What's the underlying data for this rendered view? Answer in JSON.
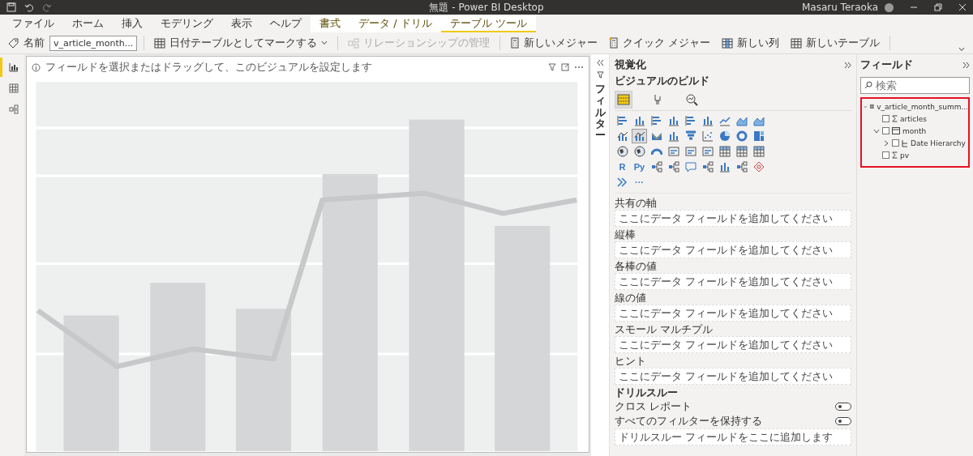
{
  "title_bar": {
    "title": "無題 - Power BI Desktop",
    "user": "Masaru Teraoka"
  },
  "menu_tabs": [
    {
      "label": "ファイル",
      "contextual": false,
      "selected": false
    },
    {
      "label": "ホーム",
      "contextual": false,
      "selected": false
    },
    {
      "label": "挿入",
      "contextual": false,
      "selected": false
    },
    {
      "label": "モデリング",
      "contextual": false,
      "selected": false
    },
    {
      "label": "表示",
      "contextual": false,
      "selected": false
    },
    {
      "label": "ヘルプ",
      "contextual": false,
      "selected": false
    },
    {
      "label": "書式",
      "contextual": true,
      "selected": false
    },
    {
      "label": "データ / ドリル",
      "contextual": true,
      "selected": false
    },
    {
      "label": "テーブル ツール",
      "contextual": true,
      "selected": true
    }
  ],
  "ribbon": {
    "name_label": "名前",
    "name_value": "v_article_month...",
    "buttons": [
      {
        "label": "日付テーブルとしてマークする",
        "kind": "dropdown",
        "disabled": false
      },
      {
        "label": "リレーションシップの管理",
        "kind": "button",
        "disabled": true
      },
      {
        "label": "新しいメジャー",
        "kind": "button",
        "disabled": false
      },
      {
        "label": "クイック メジャー",
        "kind": "button",
        "disabled": false
      },
      {
        "label": "新しい列",
        "kind": "button",
        "disabled": false
      },
      {
        "label": "新しいテーブル",
        "kind": "button",
        "disabled": false
      }
    ]
  },
  "views": [
    {
      "selected": true
    },
    {
      "selected": false
    },
    {
      "selected": false
    }
  ],
  "canvas": {
    "hint": "フィールドを選択またはドラッグして、このビジュアルを設定します"
  },
  "filters": {
    "label": "フィルター"
  },
  "visualizations": {
    "title": "視覚化",
    "subtitle": "ビジュアルのビルド",
    "build_tabs": [
      {
        "selected": true
      },
      {
        "selected": false
      },
      {
        "selected": false
      }
    ],
    "gallery": [
      {
        "kind": "hbar",
        "selected": false
      },
      {
        "kind": "vbar",
        "selected": false
      },
      {
        "kind": "hbar",
        "selected": false
      },
      {
        "kind": "vbar",
        "selected": false
      },
      {
        "kind": "hbar",
        "selected": false
      },
      {
        "kind": "vbar",
        "selected": false
      },
      {
        "kind": "line",
        "selected": false
      },
      {
        "kind": "area",
        "selected": false
      },
      {
        "kind": "area",
        "selected": false
      },
      {
        "kind": "combo",
        "selected": false
      },
      {
        "kind": "combo",
        "selected": true
      },
      {
        "kind": "ribbon",
        "selected": false
      },
      {
        "kind": "vbar",
        "selected": false
      },
      {
        "kind": "funnel",
        "selected": false
      },
      {
        "kind": "scatter",
        "selected": false
      },
      {
        "kind": "pie",
        "selected": false
      },
      {
        "kind": "donut",
        "selected": false
      },
      {
        "kind": "treemap",
        "selected": false
      },
      {
        "kind": "map",
        "selected": false
      },
      {
        "kind": "map",
        "selected": false
      },
      {
        "kind": "gauge",
        "selected": false
      },
      {
        "kind": "card",
        "selected": false
      },
      {
        "kind": "card",
        "selected": false
      },
      {
        "kind": "card",
        "selected": false
      },
      {
        "kind": "table",
        "selected": false
      },
      {
        "kind": "table",
        "selected": false
      },
      {
        "kind": "table",
        "selected": false
      },
      {
        "kind": "text",
        "label": "R",
        "selected": false
      },
      {
        "kind": "text",
        "label": "Py",
        "selected": false
      },
      {
        "kind": "misc",
        "selected": false
      },
      {
        "kind": "misc",
        "selected": false
      },
      {
        "kind": "bubble",
        "selected": false
      },
      {
        "kind": "misc",
        "selected": false
      },
      {
        "kind": "vbar",
        "selected": false
      },
      {
        "kind": "misc",
        "selected": false
      },
      {
        "kind": "diamond",
        "selected": false
      },
      {
        "kind": "chevrons",
        "selected": false
      },
      {
        "kind": "text",
        "label": "···",
        "selected": false
      }
    ],
    "buckets": [
      {
        "label": "共有の軸",
        "hint": "ここにデータ フィールドを追加してください"
      },
      {
        "label": "縦棒",
        "hint": "ここにデータ フィールドを追加してください"
      },
      {
        "label": "各棒の値",
        "hint": "ここにデータ フィールドを追加してください"
      },
      {
        "label": "線の値",
        "hint": "ここにデータ フィールドを追加してください"
      },
      {
        "label": "スモール マルチプル",
        "hint": "ここにデータ フィールドを追加してください"
      },
      {
        "label": "ヒント",
        "hint": "ここにデータ フィールドを追加してください"
      }
    ],
    "drillthrough": {
      "title": "ドリルスルー",
      "toggles": [
        {
          "label": "クロス レポート",
          "on": false
        },
        {
          "label": "すべてのフィルターを保持する",
          "on": false
        }
      ],
      "hint": "ドリルスルー フィールドをここに追加します"
    }
  },
  "fields": {
    "title": "フィールド",
    "search": {
      "placeholder": "検索"
    },
    "highlighted": true,
    "tree": [
      {
        "name": "v_article_month_summ...",
        "kind": "table",
        "expanded": true,
        "children": [
          {
            "name": "articles",
            "kind": "measure",
            "checked": false
          },
          {
            "name": "month",
            "kind": "date",
            "checked": false,
            "expanded": true,
            "children": [
              {
                "name": "Date Hierarchy",
                "kind": "hierarchy",
                "checked": false,
                "expanded": false
              }
            ]
          },
          {
            "name": "pv",
            "kind": "measure",
            "checked": false
          }
        ]
      }
    ]
  }
}
